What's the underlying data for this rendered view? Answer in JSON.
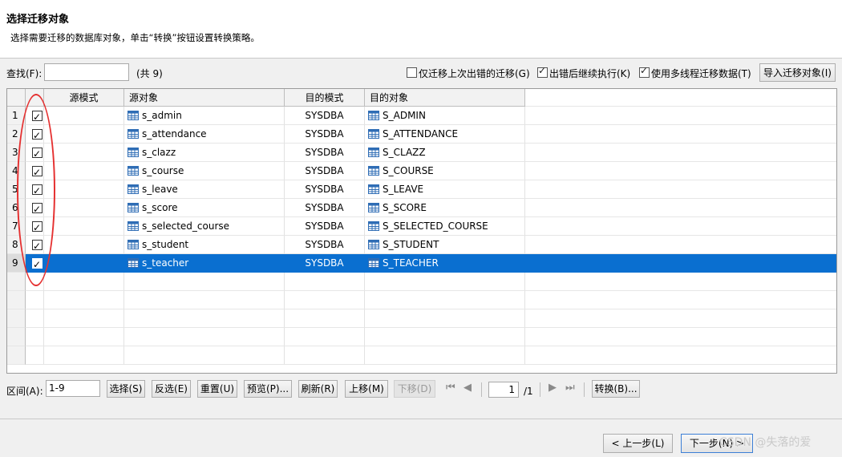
{
  "header": {
    "title": "选择迁移对象",
    "subtitle": "选择需要迁移的数据库对象，单击“转换”按钮设置转换策略。"
  },
  "toolbar": {
    "search_label": "查找(F):",
    "search_value": "",
    "count_text": "(共 9)",
    "option_failed_label": "仅迁移上次出错的迁移(G)",
    "option_failed_checked": false,
    "option_continue_label": "出错后继续执行(K)",
    "option_continue_checked": true,
    "option_multithread_label": "使用多线程迁移数据(T)",
    "option_multithread_checked": true,
    "import_button": "导入迁移对象(I)"
  },
  "table": {
    "columns": [
      "源模式",
      "源对象",
      "目的模式",
      "目的对象"
    ],
    "rows": [
      {
        "num": "1",
        "checked": true,
        "src_schema": "",
        "src_object": "s_admin",
        "dst_schema": "SYSDBA",
        "dst_object": "S_ADMIN"
      },
      {
        "num": "2",
        "checked": true,
        "src_schema": "",
        "src_object": "s_attendance",
        "dst_schema": "SYSDBA",
        "dst_object": "S_ATTENDANCE"
      },
      {
        "num": "3",
        "checked": true,
        "src_schema": "",
        "src_object": "s_clazz",
        "dst_schema": "SYSDBA",
        "dst_object": "S_CLAZZ"
      },
      {
        "num": "4",
        "checked": true,
        "src_schema": "",
        "src_object": "s_course",
        "dst_schema": "SYSDBA",
        "dst_object": "S_COURSE"
      },
      {
        "num": "5",
        "checked": true,
        "src_schema": "",
        "src_object": "s_leave",
        "dst_schema": "SYSDBA",
        "dst_object": "S_LEAVE"
      },
      {
        "num": "6",
        "checked": true,
        "src_schema": "",
        "src_object": "s_score",
        "dst_schema": "SYSDBA",
        "dst_object": "S_SCORE"
      },
      {
        "num": "7",
        "checked": true,
        "src_schema": "",
        "src_object": "s_selected_course",
        "dst_schema": "SYSDBA",
        "dst_object": "S_SELECTED_COURSE"
      },
      {
        "num": "8",
        "checked": true,
        "src_schema": "",
        "src_object": "s_student",
        "dst_schema": "SYSDBA",
        "dst_object": "S_STUDENT"
      },
      {
        "num": "9",
        "checked": true,
        "src_schema": "",
        "src_object": "s_teacher",
        "dst_schema": "SYSDBA",
        "dst_object": "S_TEACHER"
      }
    ],
    "selected_row": 9,
    "icon": "table-icon"
  },
  "bottom": {
    "range_label": "区间(A):",
    "range_value": "1-9",
    "select_button": "选择(S)",
    "invert_button": "反选(E)",
    "reset_button": "重置(U)",
    "preview_button": "预览(P)...",
    "refresh_button": "刷新(R)",
    "move_up_button": "上移(M)",
    "move_down_button": "下移(D)",
    "page_value": "1",
    "page_total": "/1",
    "convert_button": "转换(B)..."
  },
  "footer": {
    "prev_button": "< 上一步(L)",
    "next_button": "下一步(N) >"
  },
  "watermark": "CSDN @失落的爱",
  "colors": {
    "selection": "#0a6fd0",
    "annotation": "#e53030"
  }
}
